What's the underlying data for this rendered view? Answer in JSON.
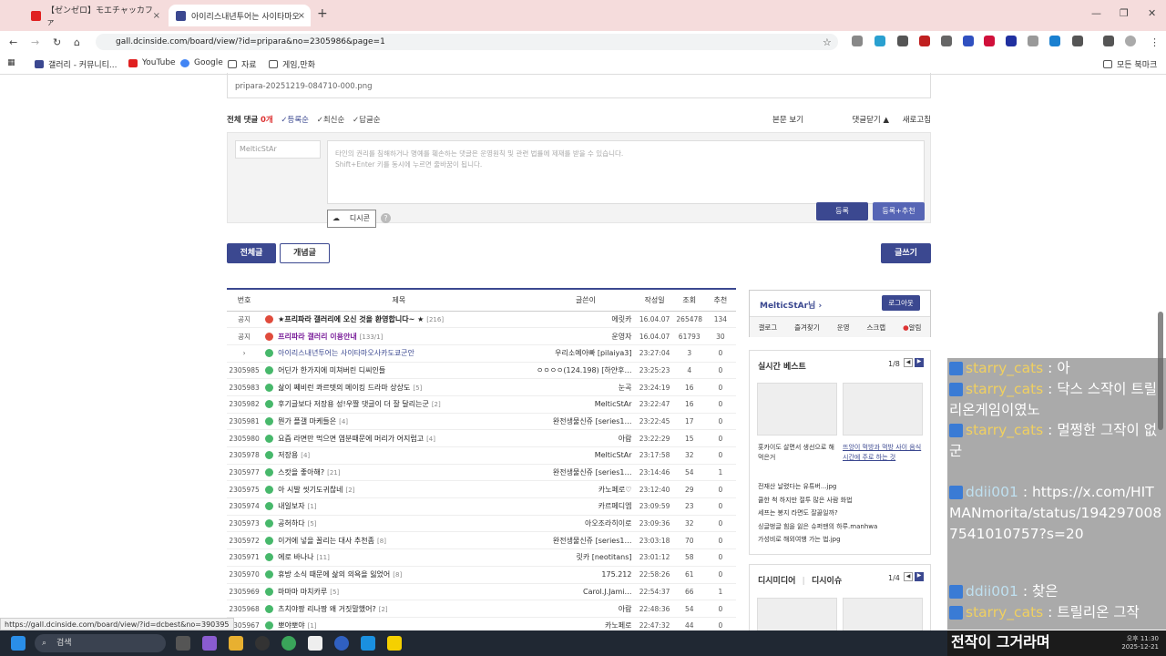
{
  "browser": {
    "tabs": [
      {
        "title": "【ゼンゼロ】モエチャッカファ",
        "favicon_color": "#e02020",
        "active": false
      },
      {
        "title": "아이리스내년투어는 사이타마오",
        "favicon_color": "#3b4890",
        "active": true
      }
    ],
    "new_tab": "+",
    "url": "gall.dcinside.com/board/view/?id=pripara&no=2305986&page=1",
    "bookmarks": [
      "갤러리 - 커뮤니티...",
      "YouTube",
      "Google",
      "자료",
      "게임,만화"
    ],
    "all_bookmarks": "모든 북마크",
    "status_url": "https://gall.dcinside.com/board/view/?id=dcbest&no=390395"
  },
  "attachment": {
    "file": "pripara-20251219-084710-000.png"
  },
  "comments": {
    "count_label": "전체 댓글",
    "count": "0개",
    "sort": [
      "등록순",
      "최신순",
      "답글순"
    ],
    "right": [
      "본문 보기",
      "댓글닫기",
      "새로고침"
    ],
    "nick": "MelticStAr",
    "placeholder1": "타인의 권리를 침해하거나 명예를 훼손하는 댓글은 운영원칙 및 관련 법률에 제재를 받을 수 있습니다.",
    "placeholder2": "Shift+Enter 키를 동시에 누르면 줄바꿈이 됩니다.",
    "dccon": "디시콘",
    "submit": "등록",
    "submit_rec": "등록+추천"
  },
  "board_tabs": {
    "all": "전체글",
    "concept": "개념글",
    "write": "글쓰기"
  },
  "table": {
    "headers": [
      "번호",
      "제목",
      "글쓴이",
      "작성일",
      "조회",
      "추천"
    ],
    "rows": [
      {
        "no": "공지",
        "icon": "red",
        "title": "★프리파라 갤러리에 오신 것을 환영합니다~ ★",
        "rc": "[216]",
        "writer": "에릿카",
        "date": "16.04.07",
        "views": "265478",
        "rec": "134",
        "style": "notice"
      },
      {
        "no": "공지",
        "icon": "red",
        "title": "프리파라 갤러리 이용안내",
        "rc": "[133/1]",
        "writer": "운영자",
        "date": "16.04.07",
        "views": "61793",
        "rec": "30",
        "style": "notice2"
      },
      {
        "no": "›",
        "icon": "grn",
        "title": "아이리스내년투어는 사이타마오사카도쿄군안",
        "rc": "",
        "writer": "우리소예아빠 [pilaiya3]",
        "date": "23:27:04",
        "views": "3",
        "rec": "0",
        "style": "cur"
      },
      {
        "no": "2305985",
        "icon": "grn",
        "title": "어딘가 한가지에 미쳐버린 디씨인들",
        "rc": "",
        "writer": "ㅇㅇㅇㅇ(124.198) [하얀후…",
        "date": "23:25:23",
        "views": "4",
        "rec": "0",
        "style": ""
      },
      {
        "no": "2305983",
        "icon": "grn",
        "title": "삶이 쩨비런 콰르텟의 메이킹 드라마 상상도",
        "rc": "[5]",
        "writer": "눈곡",
        "date": "23:24:19",
        "views": "16",
        "rec": "0",
        "style": ""
      },
      {
        "no": "2305982",
        "icon": "grn",
        "title": "후기글보다 저장용 성!우짤 댓글이 더 잘 달리는군",
        "rc": "[2]",
        "writer": "MelticStAr",
        "date": "23:22:47",
        "views": "16",
        "rec": "0",
        "style": ""
      },
      {
        "no": "2305981",
        "icon": "grn",
        "title": "뭔가 플갤 마케들은",
        "rc": "[4]",
        "writer": "완전생물신쥬 [series1…",
        "date": "23:22:45",
        "views": "17",
        "rec": "0",
        "style": ""
      },
      {
        "no": "2305980",
        "icon": "grn",
        "title": "요즘 라면만 먹으면 염분때문에 머리가 어지럽고",
        "rc": "[4]",
        "writer": "아람",
        "date": "23:22:29",
        "views": "15",
        "rec": "0",
        "style": ""
      },
      {
        "no": "2305978",
        "icon": "grn",
        "title": "저장용",
        "rc": "[4]",
        "writer": "MelticStAr",
        "date": "23:17:58",
        "views": "32",
        "rec": "0",
        "style": ""
      },
      {
        "no": "2305977",
        "icon": "grn",
        "title": "스캇을 좋아해?",
        "rc": "[21]",
        "writer": "완전생물신쥬 [series1…",
        "date": "23:14:46",
        "views": "54",
        "rec": "1",
        "style": ""
      },
      {
        "no": "2305975",
        "icon": "grn",
        "title": "아 시발 씻기도귀찮네",
        "rc": "[2]",
        "writer": "카노페로♡",
        "date": "23:12:40",
        "views": "29",
        "rec": "0",
        "style": ""
      },
      {
        "no": "2305974",
        "icon": "grn",
        "title": "내일보자",
        "rc": "[1]",
        "writer": "카르페디엠",
        "date": "23:09:59",
        "views": "23",
        "rec": "0",
        "style": ""
      },
      {
        "no": "2305973",
        "icon": "grn",
        "title": "공허하다",
        "rc": "[5]",
        "writer": "아오조라히이로",
        "date": "23:09:36",
        "views": "32",
        "rec": "0",
        "style": ""
      },
      {
        "no": "2305972",
        "icon": "grn",
        "title": "이거에 넣을 꼴리는 대사 추천좀",
        "rc": "[8]",
        "writer": "완전생물신쥬 [series1…",
        "date": "23:03:18",
        "views": "70",
        "rec": "0",
        "style": ""
      },
      {
        "no": "2305971",
        "icon": "grn",
        "title": "에로 바나나",
        "rc": "[11]",
        "writer": "릿카 [neotitans]",
        "date": "23:01:12",
        "views": "58",
        "rec": "0",
        "style": ""
      },
      {
        "no": "2305970",
        "icon": "grn",
        "title": "휴방 소식 때문에 삶의 의욕을 잃었어",
        "rc": "[8]",
        "writer": "175.212",
        "date": "22:58:26",
        "views": "61",
        "rec": "0",
        "style": ""
      },
      {
        "no": "2305969",
        "icon": "grn",
        "title": "마마마 마치카루",
        "rc": "[5]",
        "writer": "Carol.J.Jami…",
        "date": "22:54:37",
        "views": "66",
        "rec": "1",
        "style": ""
      },
      {
        "no": "2305968",
        "icon": "grn",
        "title": "츠치야짱 리나짱 왜 거짓말했어?",
        "rc": "[2]",
        "writer": "아람",
        "date": "22:48:36",
        "views": "54",
        "rec": "0",
        "style": ""
      },
      {
        "no": "2305967",
        "icon": "grn",
        "title": "뽀야뽀야",
        "rc": "[1]",
        "writer": "카노페로",
        "date": "22:47:32",
        "views": "44",
        "rec": "0",
        "style": ""
      }
    ]
  },
  "sidebar": {
    "user": "MelticStAr님",
    "logout": "로그아웃",
    "menu": [
      "갤로그",
      "즐겨찾기",
      "운영",
      "스크랩",
      "알림"
    ],
    "realtime": "실시간 베스트",
    "page": "1/8",
    "thumb1": "홋카이도 살면서 생선으로 해먹은거",
    "thumb2": "뜨앙이 먹방과 먹방 사이 음식 시간에 주로 하는 것",
    "best_list": [
      "전재산 날렸다는 유튜버...jpg",
      "쿨한 척 하지만 절투 많은 사람 화법",
      "세프는 봉지 라면도 잘끓일까?",
      "싱글벙글 힘을 잃은 슈퍼맨의 하루.manhwa",
      "가성비로 해외여행 가는 법.jpg"
    ],
    "media": "디시미디어",
    "issue": "디시이슈",
    "page2": "1/4"
  },
  "chat": [
    {
      "user": "starry_cats",
      "msg": ": 아",
      "color": "#f0d060"
    },
    {
      "user": "starry_cats",
      "msg": ": 닥스 스작이 트릴리온게임이였노",
      "color": "#f0d060"
    },
    {
      "user": "starry_cats",
      "msg": ": 멀쩡한 그작이 없군",
      "color": "#f0d060"
    },
    {
      "user": "ddii001",
      "msg": ": https://x.com/HITMANmorita/status/1942970087541010757?s=20",
      "color": "#bfe0f0"
    },
    {
      "user": "ddii001",
      "msg": ": 찾은",
      "color": "#bfe0f0"
    },
    {
      "user": "starry_cats",
      "msg": ": 트릴리온 그작",
      "color": "#f0d060"
    }
  ],
  "subtitle": "전작이 그거라며",
  "taskbar": {
    "search": "검색",
    "time": "오후 11:30",
    "date": "2025-12-21"
  }
}
